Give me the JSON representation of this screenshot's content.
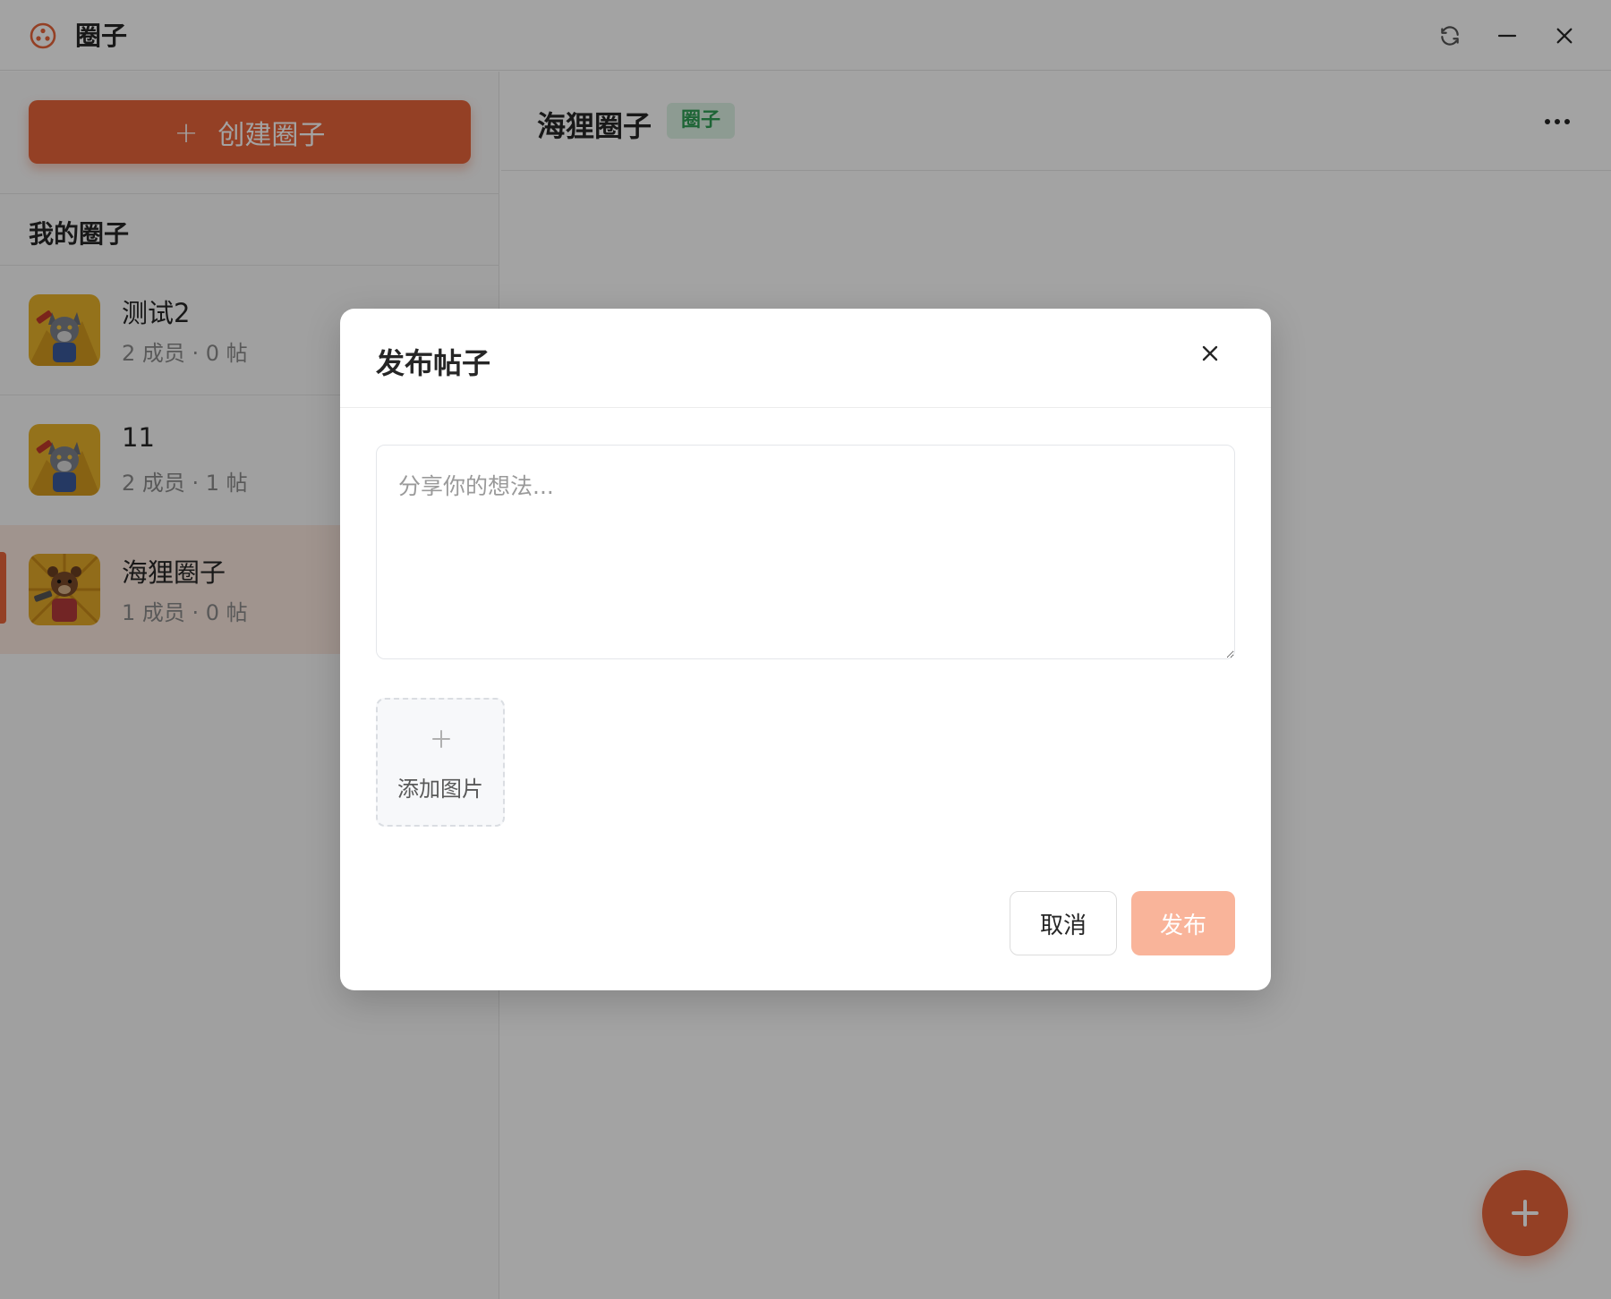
{
  "window": {
    "title": "圈子",
    "icons": {
      "logo": "app-logo-icon",
      "refresh": "refresh-icon",
      "minimize": "minimize-icon",
      "close": "close-icon"
    }
  },
  "sidebar": {
    "create_label": "创建圈子",
    "section_title": "我的圈子",
    "items": [
      {
        "name": "测试2",
        "meta": "2 成员 · 0 帖",
        "avatar": "wolf-avatar"
      },
      {
        "name": "11",
        "meta": "2 成员 · 1 帖",
        "avatar": "wolf-avatar"
      },
      {
        "name": "海狸圈子",
        "meta": "1 成员 · 0 帖",
        "avatar": "beaver-avatar",
        "active": true
      }
    ]
  },
  "main": {
    "title": "海狸圈子",
    "tag": "圈子",
    "more_icon": "more-icon",
    "fab_icon": "plus-icon"
  },
  "modal": {
    "title": "发布帖子",
    "textarea_placeholder": "分享你的想法...",
    "textarea_value": "",
    "add_image_label": "添加图片",
    "cancel_label": "取消",
    "publish_label": "发布"
  },
  "colors": {
    "accent": "#e8643a",
    "accent_disabled": "#f9b49a",
    "active_item_bg": "#fbe8df",
    "tag_bg": "#ddf3e4",
    "tag_text": "#2f9e55"
  }
}
